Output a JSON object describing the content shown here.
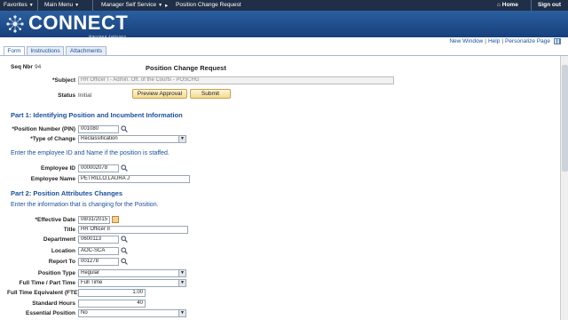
{
  "topnav": {
    "favorites": "Favorites",
    "main_menu": "Main Menu",
    "crumb1": "Manager Self Service",
    "crumb2": "Position Change Request",
    "home": "Home",
    "signout": "Sign out",
    "caret": "▼",
    "crumb_sep": "▸",
    "home_glyph": "⌂"
  },
  "banner": {
    "logo_text": "CONNECT",
    "logo_sub": "Maryland Judiciary"
  },
  "links": {
    "new_window": "New Window",
    "help": "Help",
    "personalize": "Personalize Page",
    "separator": "|"
  },
  "tabs": [
    "Form",
    "Instructions",
    "Attachments"
  ],
  "header": {
    "seq_label": "Seq Nbr",
    "seq_value": "94",
    "title": "Position Change Request",
    "subject_label": "*Subject",
    "subject_value": "HR Officer I - Admin. Off. of the Courts - POSCHG",
    "status_label": "Status",
    "status_value": "Initial",
    "preview_button": "Preview Approval",
    "submit_button": "Submit"
  },
  "part1": {
    "title": "Part 1: Identifying Position and Incumbent Information",
    "pin_label": "*Position Number (PIN)",
    "pin_value": "001080",
    "type_label": "*Type of Change",
    "type_value": "Reclassification",
    "note": "Enter the employee ID and Name if the position is staffed.",
    "emp_id_label": "Employee ID",
    "emp_id_value": "000002078",
    "emp_name_label": "Employee Name",
    "emp_name_value": "PETRILLO,LAURA J"
  },
  "part2": {
    "title": "Part 2: Position Attributes Changes",
    "note": "Enter the information that is changing for the Position.",
    "eff_date_label": "*Effective Date",
    "eff_date_value": "08/31/2015",
    "title_label": "Title",
    "title_value": "HR Officer II",
    "dept_label": "Department",
    "dept_value": "0600113",
    "location_label": "Location",
    "location_value": "AOC-SCA",
    "report_label": "Report To",
    "report_value": "001278",
    "pos_type_label": "Position Type",
    "pos_type_value": "Regular",
    "ft_pt_label": "Full Time / Part Time",
    "ft_pt_value": "Full Time",
    "fte_label": "Full Time Equivalent (FTE)",
    "fte_value": "1.00",
    "std_hours_label": "Standard Hours",
    "std_hours_value": "40",
    "essential_label": "Essential Position",
    "essential_value": "No"
  },
  "colors": {
    "nav_bg": "#1f2f47",
    "banner_bg": "#1c4a8a",
    "link": "#1a4f9c",
    "button_bg": "#f4d98f"
  }
}
